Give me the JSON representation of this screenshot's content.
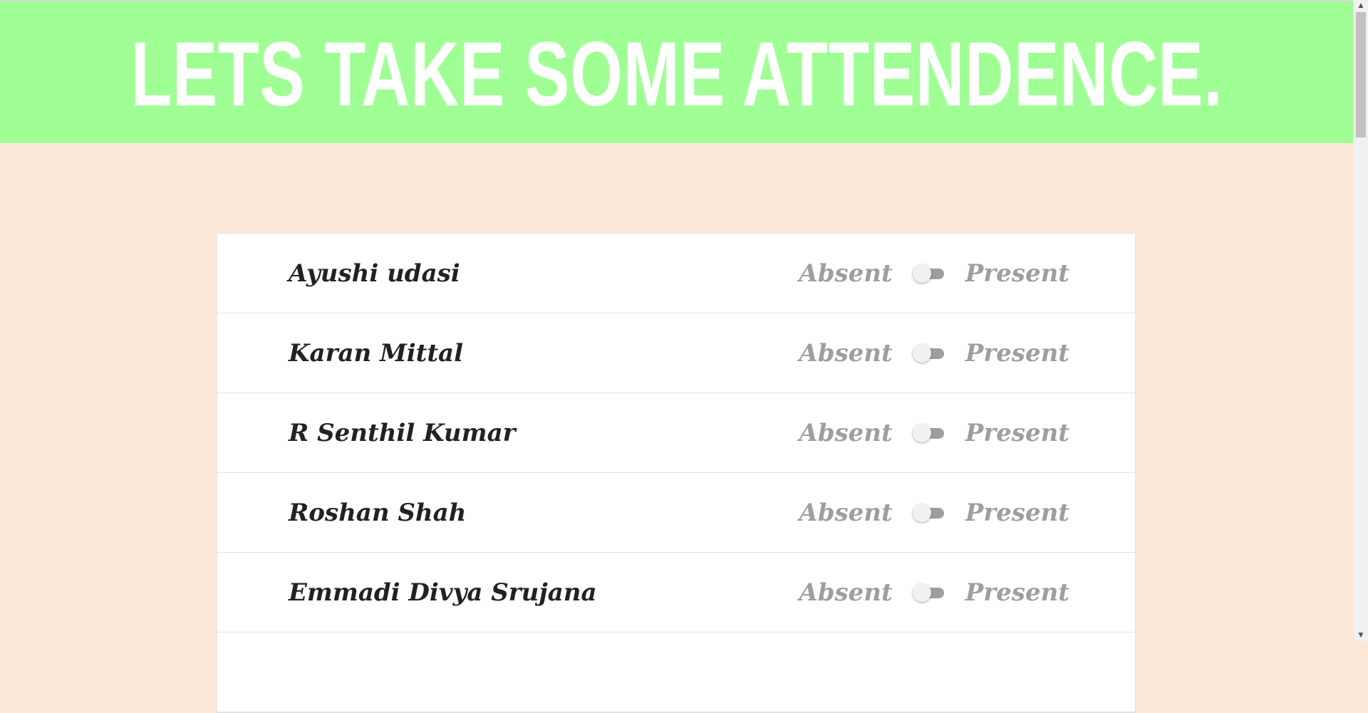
{
  "header": {
    "title": "LETS TAKE SOME ATTENDENCE."
  },
  "attendance": {
    "absent_label": "Absent",
    "present_label": "Present",
    "students": [
      {
        "name": "Ayushi udasi",
        "present": false
      },
      {
        "name": "Karan Mittal",
        "present": false
      },
      {
        "name": "R Senthil Kumar",
        "present": false
      },
      {
        "name": "Roshan Shah",
        "present": false
      },
      {
        "name": "Emmadi Divya Srujana",
        "present": false
      }
    ]
  },
  "colors": {
    "header_bg": "#a0ff94",
    "page_bg": "#fde8d7",
    "label_grey": "#9e9e9e",
    "name_dark": "#222222"
  },
  "icons": {
    "scroll_up": "▲",
    "scroll_down": "▼"
  }
}
